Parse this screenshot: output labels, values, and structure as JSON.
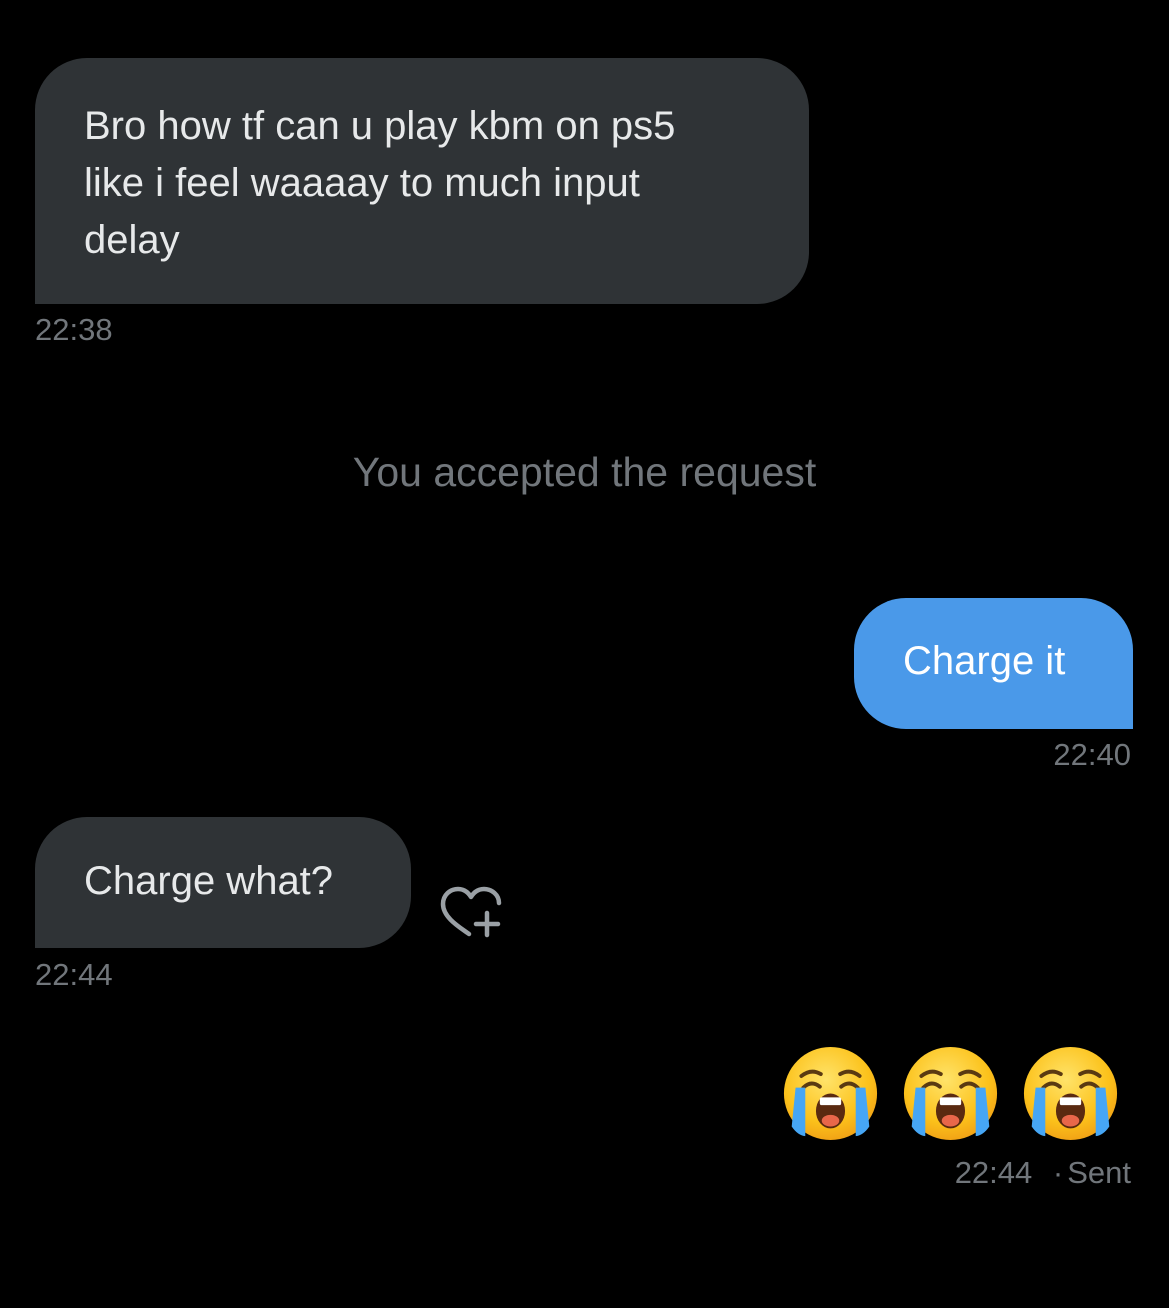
{
  "colors": {
    "background": "#000000",
    "incoming_bubble": "#2f3336",
    "outgoing_bubble": "#4a99e9",
    "muted_text": "#71767b",
    "bubble_text": "#e7e9ea"
  },
  "messages": [
    {
      "direction": "incoming",
      "text": "Bro how tf can u play kbm on ps5\nlike i feel waaaay to much input\ndelay",
      "time": "22:38"
    },
    {
      "direction": "outgoing",
      "text": "Charge it",
      "time": "22:40"
    },
    {
      "direction": "incoming",
      "text": "Charge what?",
      "time": "22:44",
      "reaction_button_icon": "heart-plus-icon"
    },
    {
      "direction": "outgoing",
      "emoji_icons": [
        "loudly-crying-face-icon",
        "loudly-crying-face-icon",
        "loudly-crying-face-icon"
      ],
      "time": "22:44",
      "status": "Sent",
      "separator": "·"
    }
  ],
  "system_note": "You accepted the request"
}
